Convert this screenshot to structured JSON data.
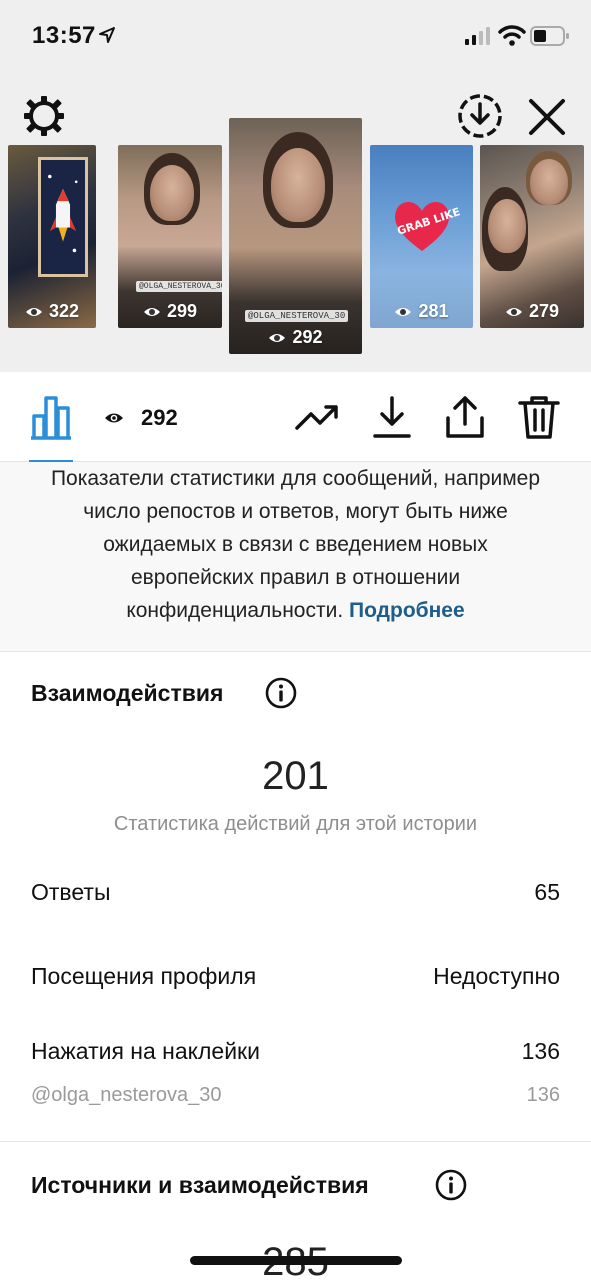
{
  "status_bar": {
    "time": "13:57"
  },
  "thumbnails": [
    {
      "views": "322"
    },
    {
      "views": "299",
      "tag": "@OLGA_NESTEROVA_30"
    },
    {
      "views": "292",
      "tag": "@OLGA_NESTEROVA_30",
      "selected": true
    },
    {
      "views": "281",
      "sticker": "GRAB LIKE"
    },
    {
      "views": "279"
    }
  ],
  "action_bar": {
    "view_count": "292"
  },
  "notice": {
    "text": "Показатели статистики для сообщений, например число репостов и ответов, могут быть ниже ожидаемых в связи с введением новых европейских правил в отношении конфиденциальности.",
    "link": "Подробнее"
  },
  "interactions": {
    "title": "Взаимодействия",
    "total": "201",
    "caption": "Статистика действий для этой истории",
    "rows": [
      {
        "label": "Ответы",
        "value": "65"
      },
      {
        "label": "Посещения профиля",
        "value": "Недоступно"
      },
      {
        "label": "Нажатия на наклейки",
        "value": "136"
      }
    ],
    "sub_row": {
      "label": "@olga_nesterova_30",
      "value": "136"
    }
  },
  "sources": {
    "title": "Источники и взаимодействия",
    "total": "285"
  },
  "colors": {
    "accent": "#2a8fd8",
    "link": "#1f5d8a",
    "muted": "#8e8e8e"
  }
}
